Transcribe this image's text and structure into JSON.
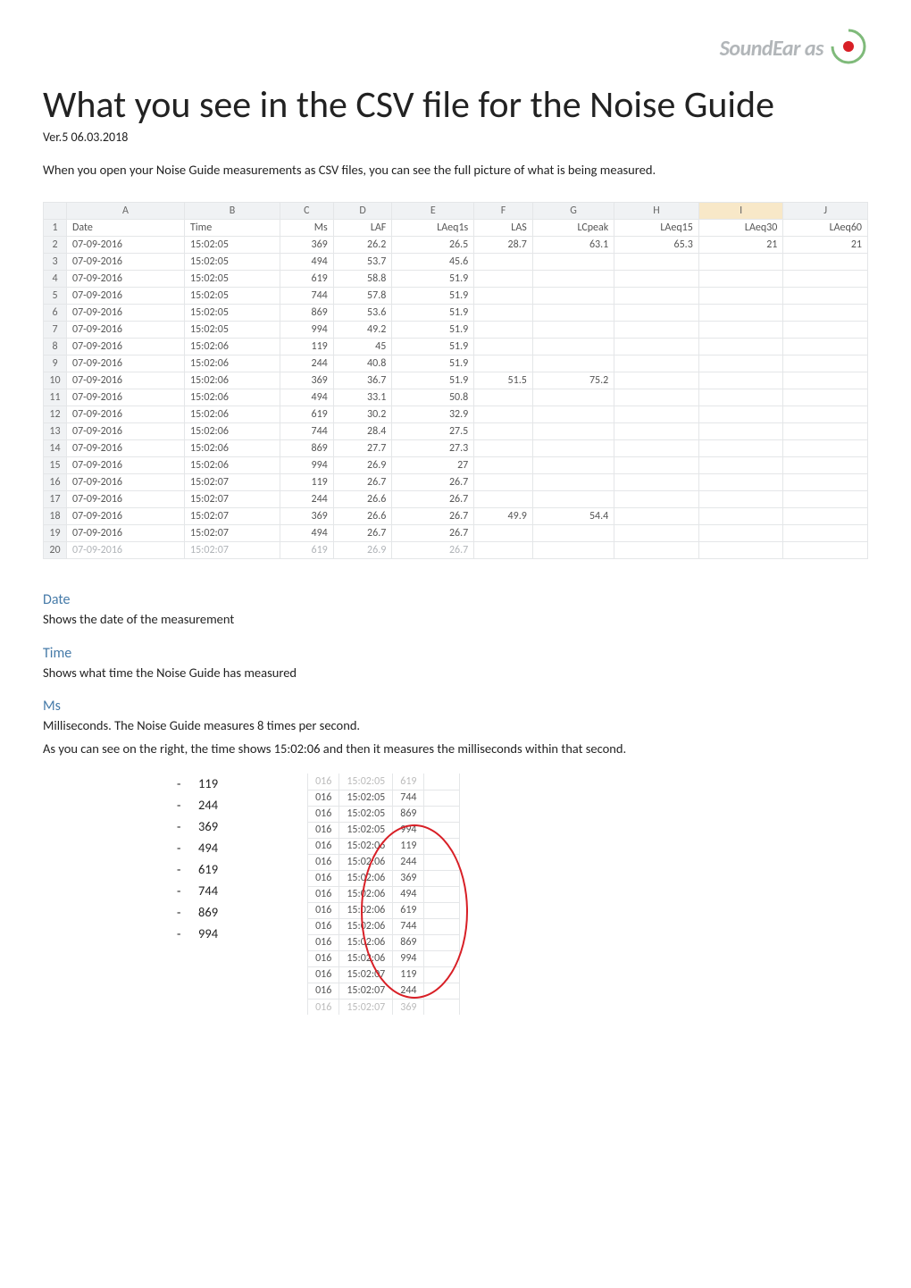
{
  "logo_text": "SoundEar as",
  "title": "What you see in the CSV file for the Noise Guide",
  "version": "Ver.5 06.03.2018",
  "intro": "When you open your Noise Guide measurements as CSV files, you can see the full picture of what is being measured.",
  "cols": [
    "A",
    "B",
    "C",
    "D",
    "E",
    "F",
    "G",
    "H",
    "I",
    "J"
  ],
  "headers": [
    "Date",
    "Time",
    "Ms",
    "LAF",
    "LAeq1s",
    "LAS",
    "LCpeak",
    "LAeq15",
    "LAeq30",
    "LAeq60"
  ],
  "rows": [
    [
      "07-09-2016",
      "15:02:05",
      "369",
      "26.2",
      "26.5",
      "28.7",
      "63.1",
      "65.3",
      "21",
      "21"
    ],
    [
      "07-09-2016",
      "15:02:05",
      "494",
      "53.7",
      "45.6",
      "",
      "",
      "",
      "",
      ""
    ],
    [
      "07-09-2016",
      "15:02:05",
      "619",
      "58.8",
      "51.9",
      "",
      "",
      "",
      "",
      ""
    ],
    [
      "07-09-2016",
      "15:02:05",
      "744",
      "57.8",
      "51.9",
      "",
      "",
      "",
      "",
      ""
    ],
    [
      "07-09-2016",
      "15:02:05",
      "869",
      "53.6",
      "51.9",
      "",
      "",
      "",
      "",
      ""
    ],
    [
      "07-09-2016",
      "15:02:05",
      "994",
      "49.2",
      "51.9",
      "",
      "",
      "",
      "",
      ""
    ],
    [
      "07-09-2016",
      "15:02:06",
      "119",
      "45",
      "51.9",
      "",
      "",
      "",
      "",
      ""
    ],
    [
      "07-09-2016",
      "15:02:06",
      "244",
      "40.8",
      "51.9",
      "",
      "",
      "",
      "",
      ""
    ],
    [
      "07-09-2016",
      "15:02:06",
      "369",
      "36.7",
      "51.9",
      "51.5",
      "75.2",
      "",
      "",
      ""
    ],
    [
      "07-09-2016",
      "15:02:06",
      "494",
      "33.1",
      "50.8",
      "",
      "",
      "",
      "",
      ""
    ],
    [
      "07-09-2016",
      "15:02:06",
      "619",
      "30.2",
      "32.9",
      "",
      "",
      "",
      "",
      ""
    ],
    [
      "07-09-2016",
      "15:02:06",
      "744",
      "28.4",
      "27.5",
      "",
      "",
      "",
      "",
      ""
    ],
    [
      "07-09-2016",
      "15:02:06",
      "869",
      "27.7",
      "27.3",
      "",
      "",
      "",
      "",
      ""
    ],
    [
      "07-09-2016",
      "15:02:06",
      "994",
      "26.9",
      "27",
      "",
      "",
      "",
      "",
      ""
    ],
    [
      "07-09-2016",
      "15:02:07",
      "119",
      "26.7",
      "26.7",
      "",
      "",
      "",
      "",
      ""
    ],
    [
      "07-09-2016",
      "15:02:07",
      "244",
      "26.6",
      "26.7",
      "",
      "",
      "",
      "",
      ""
    ],
    [
      "07-09-2016",
      "15:02:07",
      "369",
      "26.6",
      "26.7",
      "49.9",
      "54.4",
      "",
      "",
      ""
    ],
    [
      "07-09-2016",
      "15:02:07",
      "494",
      "26.7",
      "26.7",
      "",
      "",
      "",
      "",
      ""
    ],
    [
      "07-09-2016",
      "15:02:07",
      "619",
      "26.9",
      "26.7",
      "",
      "",
      "",
      "",
      ""
    ]
  ],
  "sections": {
    "date_h": "Date",
    "date_b": "Shows the date of the measurement",
    "time_h": "Time",
    "time_b": "Shows what time the Noise Guide has measured",
    "ms_h": "Ms",
    "ms_b": "Milliseconds. The Noise Guide measures 8 times per second.",
    "ms_b2": "As you can see on the right, the time shows 15:02:06 and then it measures the milliseconds within that second."
  },
  "ms_list": [
    "119",
    "244",
    "369",
    "494",
    "619",
    "744",
    "869",
    "994"
  ],
  "mini": [
    [
      "016",
      "15:02:05",
      "619"
    ],
    [
      "016",
      "15:02:05",
      "744"
    ],
    [
      "016",
      "15:02:05",
      "869"
    ],
    [
      "016",
      "15:02:05",
      "994"
    ],
    [
      "016",
      "15:02:06",
      "119"
    ],
    [
      "016",
      "15:02:06",
      "244"
    ],
    [
      "016",
      "15:02:06",
      "369"
    ],
    [
      "016",
      "15:02:06",
      "494"
    ],
    [
      "016",
      "15:02:06",
      "619"
    ],
    [
      "016",
      "15:02:06",
      "744"
    ],
    [
      "016",
      "15:02:06",
      "869"
    ],
    [
      "016",
      "15:02:06",
      "994"
    ],
    [
      "016",
      "15:02:07",
      "119"
    ],
    [
      "016",
      "15:02:07",
      "244"
    ],
    [
      "016",
      "15:02:07",
      "369"
    ]
  ]
}
